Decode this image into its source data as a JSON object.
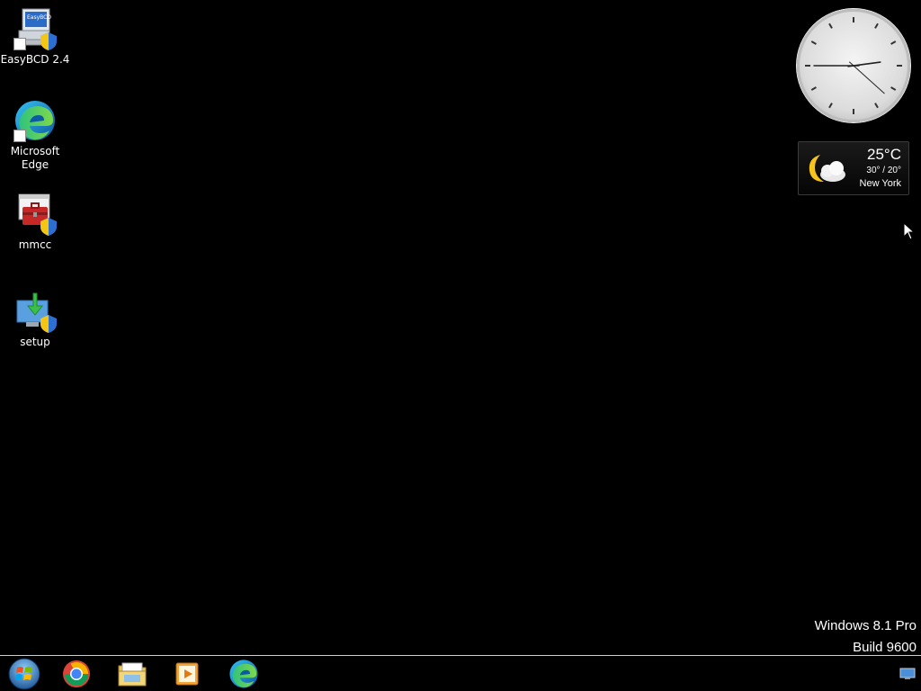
{
  "desktop": {
    "icons": [
      {
        "label": "EasyBCD 2.4",
        "icon": "easybcd-icon"
      },
      {
        "label": "Microsoft\nEdge",
        "icon": "edge-icon"
      },
      {
        "label": "mmcc",
        "icon": "toolbox-icon"
      },
      {
        "label": "setup",
        "icon": "setup-icon"
      }
    ]
  },
  "gadgets": {
    "clock": {
      "hour": 2,
      "minute": 45,
      "second": 22
    },
    "weather": {
      "temperature": "25°C",
      "range": "30° / 20°",
      "city": "New York",
      "condition_icon": "moon-cloud-icon"
    }
  },
  "watermark": {
    "line1": "Windows 8.1 Pro",
    "line2": "Build 9600"
  },
  "taskbar": {
    "buttons": [
      "start-orb-icon",
      "chrome-icon",
      "file-explorer-icon",
      "media-player-icon",
      "edge-icon"
    ],
    "tray": [
      "show-desktop-icon"
    ]
  },
  "colors": {
    "desktop_background": "#000000",
    "taskbar_border": "#cfcfcf"
  }
}
